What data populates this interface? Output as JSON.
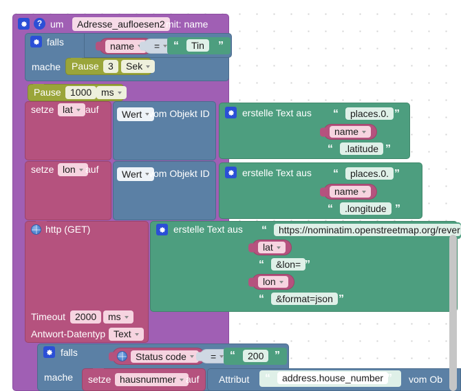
{
  "app": {
    "type": "blockly-visual-programming-editor",
    "language": "de",
    "background": "#ffffff",
    "grid_color": "#d3d3d3"
  },
  "colors": {
    "procedure_purple": "#a05fb4",
    "control_blue": "#5b80a5",
    "timing_olive": "#9aa53a",
    "variable_pink": "#b5527e",
    "text_green": "#4d9e7f",
    "logic_lightblue": "#cfd8e3",
    "icon_blue": "#2b4fd6"
  },
  "procedure": {
    "gear_icon": "gear-icon",
    "help_icon": "question-mark-icon",
    "keyword": "um",
    "name": "Adresse_aufloesen2",
    "params_label": "mit: name"
  },
  "if_block_1": {
    "gear_icon": "gear-icon",
    "keyword": "falls",
    "do_keyword": "mache",
    "condition": {
      "left_variable": "name",
      "operator": "=",
      "right_text": "Tin"
    },
    "body": {
      "pause_label": "Pause",
      "pause_value": "3",
      "pause_unit": "Sek"
    }
  },
  "pause_block": {
    "label": "Pause",
    "value": "1000",
    "unit": "ms"
  },
  "set_lat": {
    "keyword": "setze",
    "variable": "lat",
    "to_keyword": "auf",
    "value_source": {
      "selector": "Wert",
      "label": "vom Objekt ID"
    },
    "text_join": {
      "gear_icon": "gear-icon",
      "label": "erstelle Text aus",
      "items": [
        "places.0.",
        "name",
        ".latitude"
      ],
      "item_types": [
        "text",
        "variable",
        "text"
      ]
    }
  },
  "set_lon": {
    "keyword": "setze",
    "variable": "lon",
    "to_keyword": "auf",
    "value_source": {
      "selector": "Wert",
      "label": "vom Objekt ID"
    },
    "text_join": {
      "gear_icon": "gear-icon",
      "label": "erstelle Text aus",
      "items": [
        "places.0.",
        "name",
        ".longitude"
      ],
      "item_types": [
        "text",
        "variable",
        "text"
      ]
    }
  },
  "http_block": {
    "globe_icon": "globe-icon",
    "label": "http (GET)",
    "timeout_label": "Timeout",
    "timeout_value": "2000",
    "timeout_unit": "ms",
    "response_type_label": "Antwort-Datentyp",
    "response_type_value": "Text",
    "url_join": {
      "gear_icon": "gear-icon",
      "label": "erstelle Text aus",
      "items": [
        "https://nominatim.openstreetmap.org/rever",
        "lat",
        "&lon=",
        "lon",
        "&format=json"
      ],
      "item_types": [
        "text",
        "variable",
        "text",
        "variable",
        "text"
      ]
    }
  },
  "if_block_2": {
    "gear_icon": "gear-icon",
    "keyword": "falls",
    "do_keyword": "mache",
    "condition": {
      "globe_icon": "globe-icon",
      "left_variable": "Status code",
      "operator": "=",
      "right_text": "200"
    },
    "body": {
      "keyword": "setze",
      "variable": "hausnummer",
      "to_keyword": "auf",
      "attribute_label": "Attribut",
      "attribute_value": "address.house_number",
      "from_label": "vom Ob"
    }
  },
  "scrollbar": {
    "name": "vertical-scrollbar",
    "color": "#c6c6c6"
  }
}
